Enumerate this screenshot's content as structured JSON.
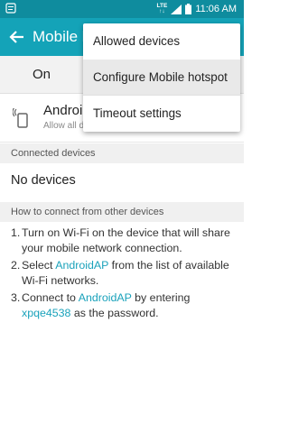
{
  "status_bar": {
    "network": "LTE",
    "time": "11:06 AM"
  },
  "app_bar": {
    "title": "Mobile hotspot"
  },
  "toggle": {
    "label": "On"
  },
  "network": {
    "name": "AndroidAP",
    "subtitle": "Allow all devices to connect"
  },
  "connected": {
    "header": "Connected devices",
    "empty": "No devices"
  },
  "howto": {
    "header": "How to connect from other devices",
    "step1_num": "1.",
    "step1": "Turn on Wi-Fi on the device that will share your mobile network connection.",
    "step2_num": "2.",
    "step2_pre": "Select ",
    "step2_link": "AndroidAP",
    "step2_post": " from the list of available Wi-Fi networks.",
    "step3_num": "3.",
    "step3_pre": "Connect to ",
    "step3_link1": "AndroidAP",
    "step3_mid": " by entering ",
    "step3_link2": "xpqe4538",
    "step3_post": " as the password."
  },
  "menu": {
    "items": [
      {
        "label": "Allowed devices"
      },
      {
        "label": "Configure Mobile hotspot"
      },
      {
        "label": "Timeout settings"
      }
    ]
  }
}
